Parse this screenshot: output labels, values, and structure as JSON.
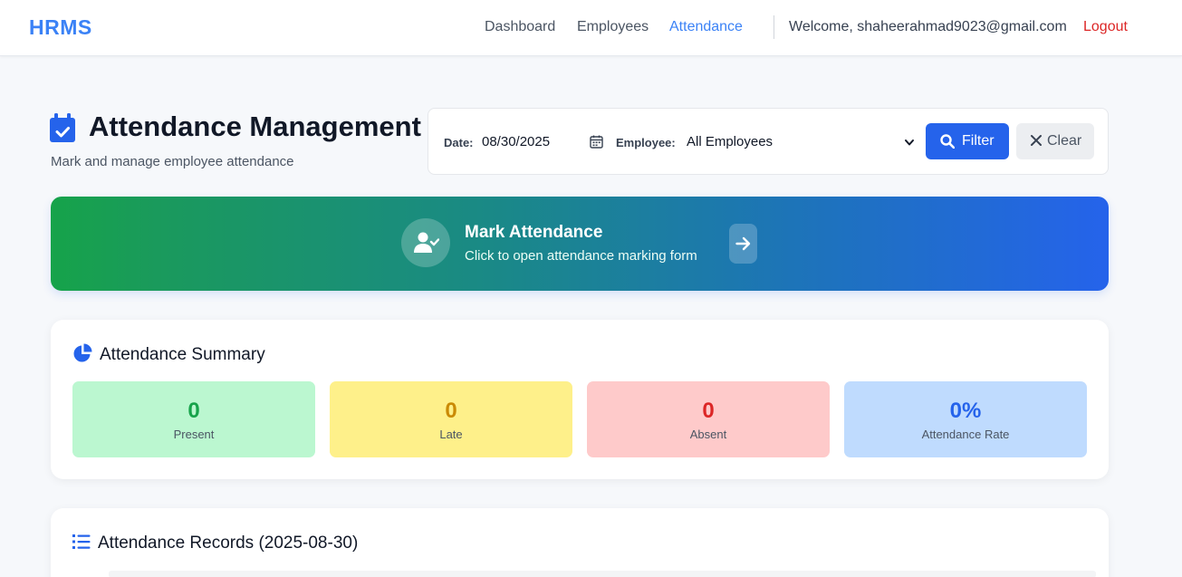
{
  "nav": {
    "brand": "HRMS",
    "links": [
      "Dashboard",
      "Employees",
      "Attendance"
    ],
    "active": "Attendance",
    "welcome": "Welcome, shaheerahmad9023@gmail.com",
    "logout": "Logout"
  },
  "header": {
    "title": "Attendance Management",
    "subtitle": "Mark and manage employee attendance",
    "icon": "calendar-check-icon"
  },
  "filters": {
    "date_label": "Date:",
    "date_value": "08/30/2025",
    "employee_label": "Employee:",
    "employee_selected": "All Employees",
    "filter_button": "Filter",
    "clear_button": "Clear"
  },
  "banner": {
    "title": "Mark Attendance",
    "subtitle": "Click to open attendance marking form",
    "icon": "user-check-icon",
    "arrow_icon": "arrow-right-icon"
  },
  "summary": {
    "title": "Attendance Summary",
    "icon": "pie-chart-icon",
    "stats": [
      {
        "value": "0",
        "label": "Present",
        "color": "#16a34a"
      },
      {
        "value": "0",
        "label": "Late",
        "color": "#ca8a04"
      },
      {
        "value": "0",
        "label": "Absent",
        "color": "#dc2626"
      },
      {
        "value": "0%",
        "label": "Attendance Rate",
        "color": "#2563eb"
      }
    ]
  },
  "records": {
    "title": "Attendance Records (2025-08-30)",
    "icon": "list-icon"
  },
  "colors": {
    "accent": "#2563eb",
    "brand": "#3b82f6",
    "logout": "#dc2626"
  }
}
